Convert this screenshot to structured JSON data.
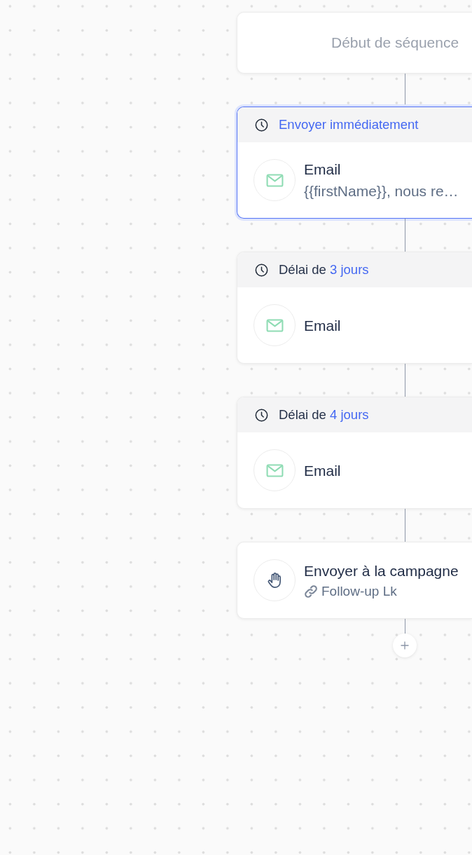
{
  "canvas": {
    "start_node": {
      "label": "Début de séquence"
    },
    "steps": [
      {
        "kind": "email",
        "selected": true,
        "delay": {
          "value": "Envoyer immédiatement"
        },
        "title": "Email",
        "subtitle": "{{firstName}}, nous re…"
      },
      {
        "kind": "email",
        "selected": false,
        "delay": {
          "label": "Délai de",
          "value": "3 jours"
        },
        "title": "Email"
      },
      {
        "kind": "email",
        "selected": false,
        "delay": {
          "label": "Délai de",
          "value": "4 jours"
        },
        "title": "Email"
      },
      {
        "kind": "campaign",
        "selected": false,
        "title": "Envoyer à la campagne",
        "link": "Follow-up Lk"
      }
    ]
  }
}
